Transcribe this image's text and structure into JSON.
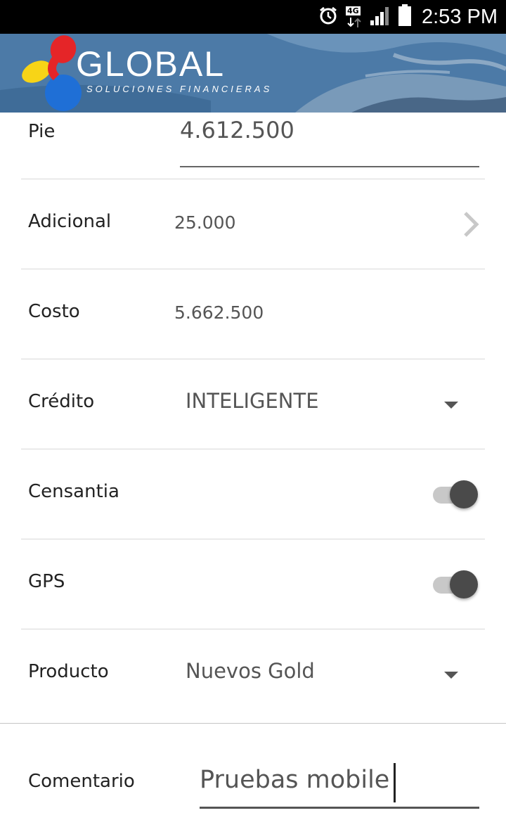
{
  "status_bar": {
    "time": "2:53 PM",
    "network": "4G",
    "icons": [
      "alarm-icon",
      "network-4g-icon",
      "signal-icon",
      "battery-icon"
    ]
  },
  "header": {
    "logo_word": "GLOBAL",
    "logo_subtitle": "SOLUCIONES FINANCIERAS"
  },
  "form": {
    "pie": {
      "label": "Pie",
      "value": "4.612.500"
    },
    "adicional": {
      "label": "Adicional",
      "value": "25.000"
    },
    "costo": {
      "label": "Costo",
      "value": "5.662.500"
    },
    "credito": {
      "label": "Crédito",
      "selected": "INTELIGENTE"
    },
    "censantia": {
      "label": "Censantia",
      "enabled": true
    },
    "gps": {
      "label": "GPS",
      "enabled": true
    },
    "producto": {
      "label": "Producto",
      "selected": "Nuevos Gold"
    },
    "comentario": {
      "label": "Comentario",
      "value": "Pruebas mobile"
    }
  },
  "colors": {
    "text": "#222222",
    "value_text": "#555555",
    "toggle_knob": "#4a4a4a",
    "toggle_track": "#c8c8c8",
    "divider": "#d8d8d8",
    "banner": "#5a87b3"
  }
}
